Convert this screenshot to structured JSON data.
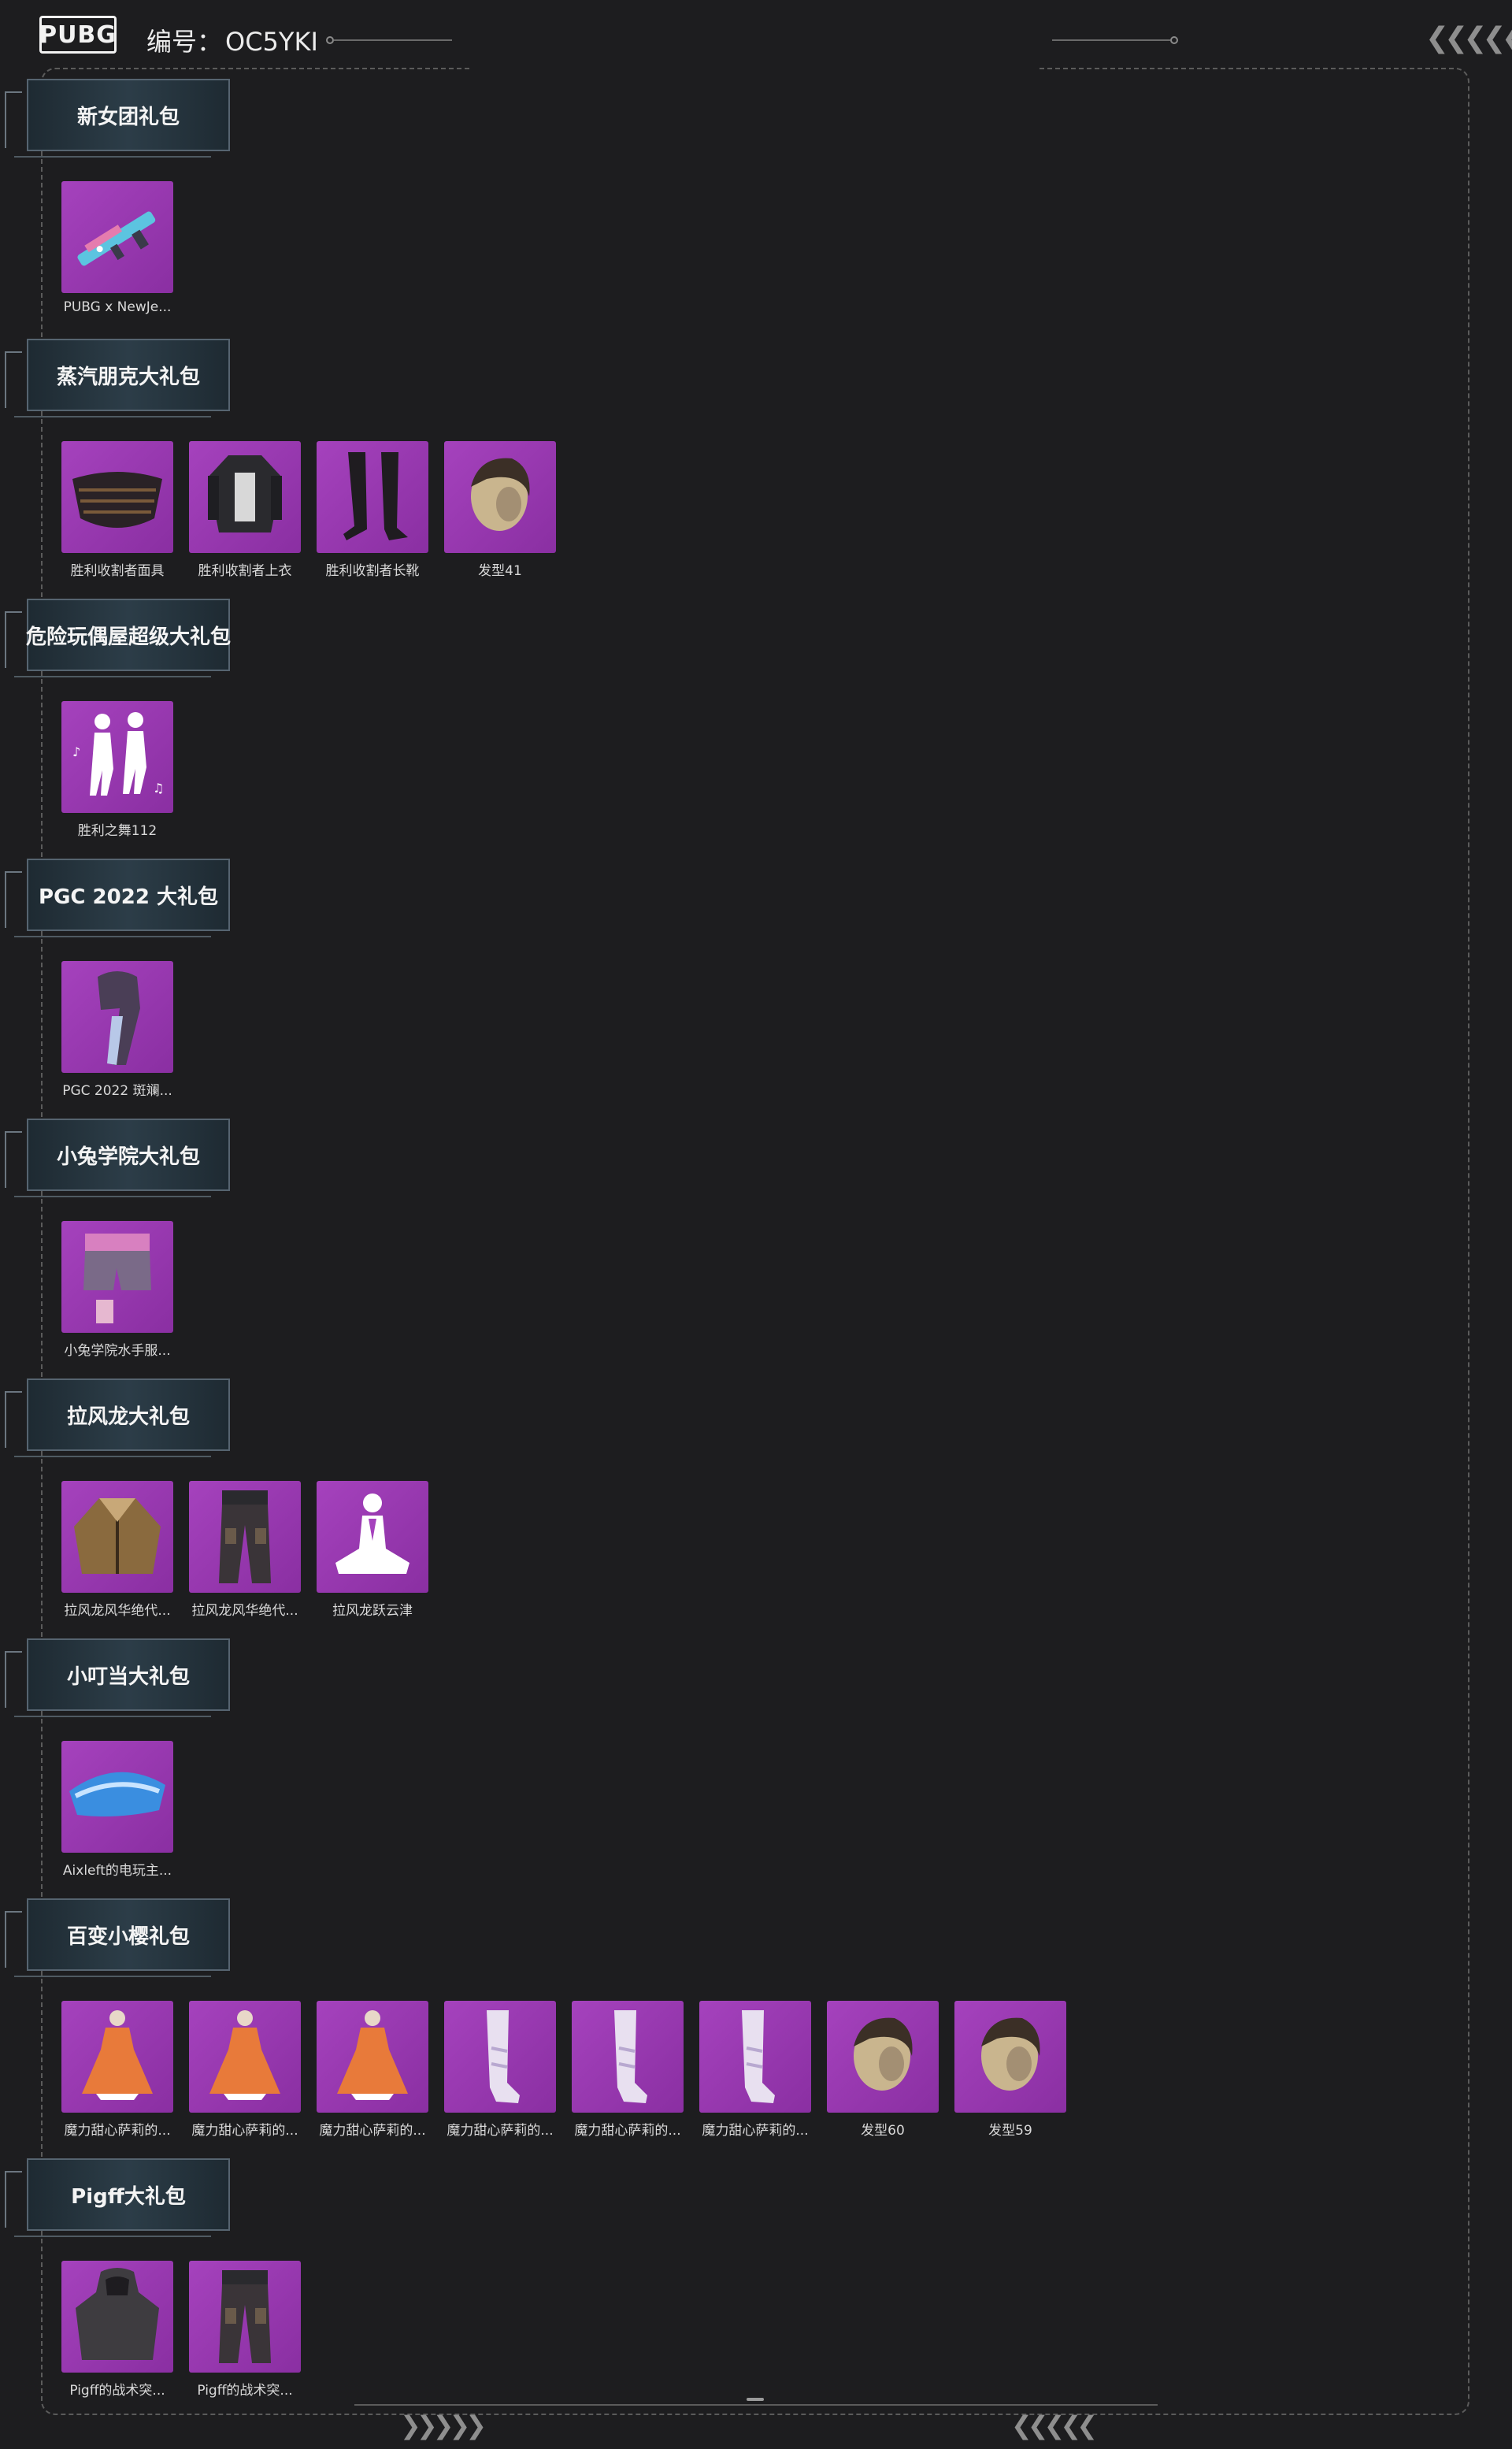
{
  "header": {
    "logo_text": "PUBG",
    "code_label": "编号：",
    "code_value": "OC5YKI"
  },
  "sections": [
    {
      "title": "新女团礼包",
      "items": [
        {
          "label": "PUBG x NewJe...",
          "icon": "rifle-skin-icon"
        }
      ]
    },
    {
      "title": "蒸汽朋克大礼包",
      "items": [
        {
          "label": "胜利收割者面具",
          "icon": "mask-icon"
        },
        {
          "label": "胜利收割者上衣",
          "icon": "top-outfit-icon"
        },
        {
          "label": "胜利收割者长靴",
          "icon": "boots-icon"
        },
        {
          "label": "发型41",
          "icon": "hairstyle-icon"
        }
      ]
    },
    {
      "title": "危险玩偶屋超级大礼包",
      "items": [
        {
          "label": "胜利之舞112",
          "icon": "dance-emote-icon"
        }
      ]
    },
    {
      "title": "PGC 2022 大礼包",
      "items": [
        {
          "label": "PGC 2022 斑斓...",
          "icon": "scarf-icon"
        }
      ]
    },
    {
      "title": "小兔学院大礼包",
      "items": [
        {
          "label": "小兔学院水手服...",
          "icon": "shorts-icon"
        }
      ]
    },
    {
      "title": "拉风龙大礼包",
      "items": [
        {
          "label": "拉风龙风华绝代...",
          "icon": "jacket-icon"
        },
        {
          "label": "拉风龙风华绝代...",
          "icon": "pants-icon"
        },
        {
          "label": "拉风龙跃云津",
          "icon": "meditation-emote-icon"
        }
      ]
    },
    {
      "title": "小叮当大礼包",
      "items": [
        {
          "label": "Aixleft的电玩主...",
          "icon": "visor-icon"
        }
      ]
    },
    {
      "title": "百变小樱礼包",
      "items": [
        {
          "label": "魔力甜心萨莉的...",
          "icon": "dress-icon"
        },
        {
          "label": "魔力甜心萨莉的...",
          "icon": "dress-icon"
        },
        {
          "label": "魔力甜心萨莉的...",
          "icon": "dress-icon"
        },
        {
          "label": "魔力甜心萨莉的...",
          "icon": "stocking-icon"
        },
        {
          "label": "魔力甜心萨莉的...",
          "icon": "stocking-icon"
        },
        {
          "label": "魔力甜心萨莉的...",
          "icon": "stocking-icon"
        },
        {
          "label": "发型60",
          "icon": "hairstyle-icon"
        },
        {
          "label": "发型59",
          "icon": "hairstyle-icon"
        }
      ]
    },
    {
      "title": "Pigff大礼包",
      "items": [
        {
          "label": "Pigff的战术突...",
          "icon": "hoodie-icon"
        },
        {
          "label": "Pigff的战术突...",
          "icon": "pants-icon"
        }
      ]
    }
  ],
  "colors": {
    "background": "#1d1d1f",
    "item_bg": "#9b3bb4",
    "section_plate": "#2c3d48"
  }
}
